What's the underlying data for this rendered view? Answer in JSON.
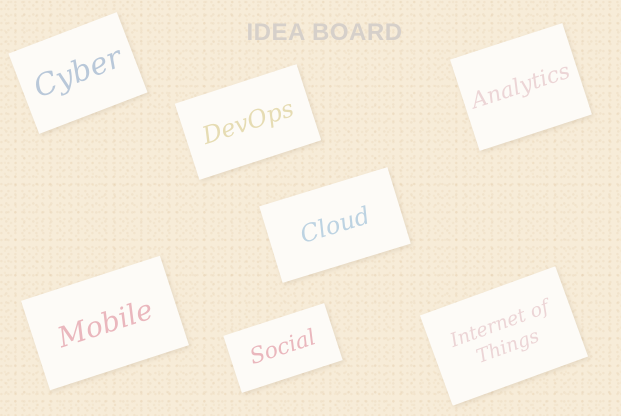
{
  "board": {
    "title": "IDEA BOARD"
  },
  "cards": {
    "cyber": {
      "label": "Cyber",
      "color": "#b9c8d9"
    },
    "devops": {
      "label": "DevOps",
      "color": "#e6dcb3"
    },
    "analytics": {
      "label": "Analytics",
      "color": "#ecd5d6"
    },
    "cloud": {
      "label": "Cloud",
      "color": "#bdd3e2"
    },
    "mobile": {
      "label": "Mobile",
      "color": "#eab7bd"
    },
    "social": {
      "label": "Social",
      "color": "#eab7bd"
    },
    "iot": {
      "label": "Internet of\nThings",
      "color": "#ecd5d6"
    }
  }
}
